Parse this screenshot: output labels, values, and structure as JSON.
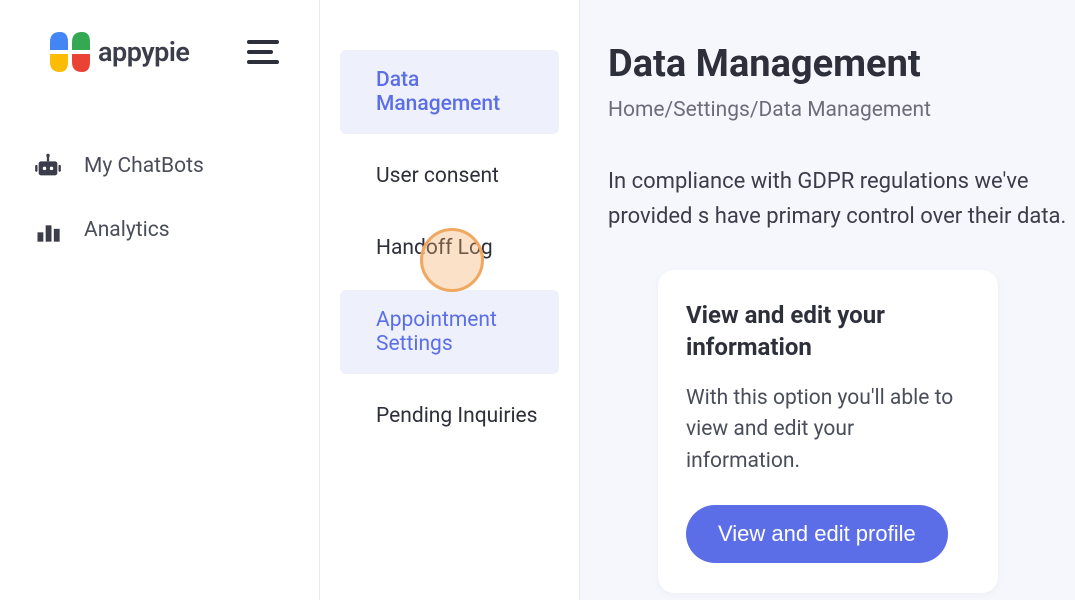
{
  "brand": {
    "name": "appypie"
  },
  "leftNav": {
    "items": [
      {
        "label": "My ChatBots",
        "icon": "robot-icon"
      },
      {
        "label": "Analytics",
        "icon": "chart-icon"
      }
    ]
  },
  "middleNav": {
    "items": [
      {
        "label": "Data Management",
        "state": "active"
      },
      {
        "label": "User consent",
        "state": ""
      },
      {
        "label": "Handoff Log",
        "state": ""
      },
      {
        "label": "Appointment Settings",
        "state": "hover"
      },
      {
        "label": "Pending Inquiries",
        "state": ""
      }
    ]
  },
  "page": {
    "title": "Data Management",
    "breadcrumb": "Home/Settings/Data Management",
    "intro": "In compliance with GDPR regulations we've provided s have primary control over their data."
  },
  "card": {
    "title": "View and edit your information",
    "description": "With this option you'll able to view and edit your information.",
    "button": "View and edit profile"
  }
}
